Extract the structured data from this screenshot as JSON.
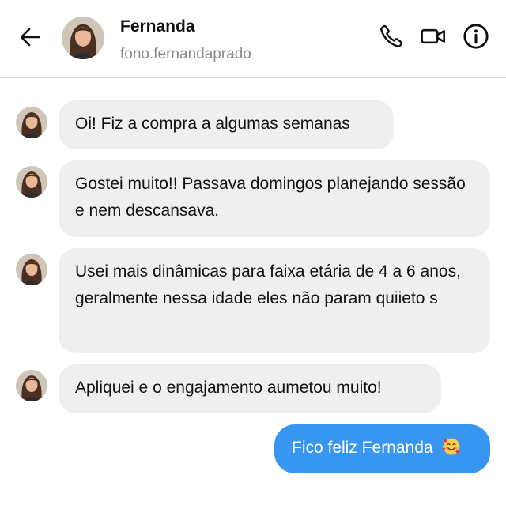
{
  "header": {
    "name": "Fernanda",
    "handle": "fono.fernandaprado",
    "icons": {
      "back": "back-arrow-icon",
      "call": "phone-icon",
      "video": "video-camera-icon",
      "info": "info-icon"
    }
  },
  "messages": [
    {
      "sender": "Fernanda",
      "text": "Oi! Fiz a compra a algumas semanas"
    },
    {
      "sender": "Fernanda",
      "text": "Gostei  muito!! Passava domingos planejando sessão e nem descansava."
    },
    {
      "sender": "Fernanda",
      "text": "Usei mais dinâmicas para faixa etária de 4 a 6 anos, geralmente nessa idade eles não param quiieto s"
    },
    {
      "sender": "Fernanda",
      "text": "Apliquei e o engajamento aumetou muito!"
    },
    {
      "sender": "me",
      "text": "Fico feliz Fernanda",
      "emoji": "🥰"
    }
  ],
  "colors": {
    "incoming_bubble": "#efefef",
    "outgoing_bubble": "#3797f0",
    "divider": "#dcdcdc",
    "handle_text": "#8a8a8a"
  }
}
